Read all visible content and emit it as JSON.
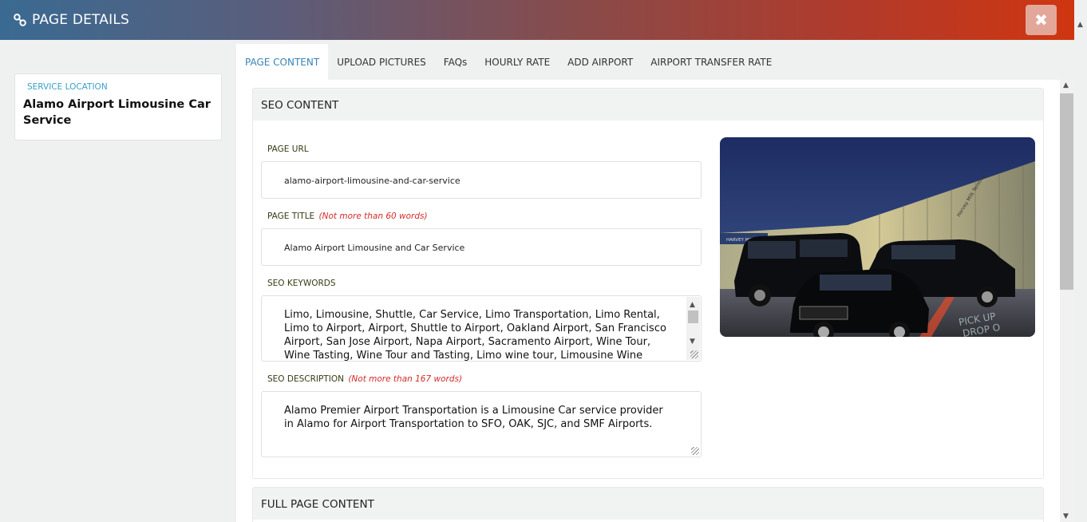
{
  "header": {
    "title": "PAGE DETAILS",
    "link_icon": "link-icon",
    "close_icon": "close-icon",
    "close_label": "✖"
  },
  "sidebar": {
    "service_location_label": "SERVICE LOCATION",
    "service_location_name": "Alamo Airport Limousine Car Service"
  },
  "tabs": [
    {
      "label": "PAGE CONTENT",
      "active": true
    },
    {
      "label": "UPLOAD PICTURES",
      "active": false
    },
    {
      "label": "FAQs",
      "active": false
    },
    {
      "label": "HOURLY RATE",
      "active": false
    },
    {
      "label": "ADD AIRPORT",
      "active": false
    },
    {
      "label": "AIRPORT TRANSFER RATE",
      "active": false
    }
  ],
  "seo": {
    "heading": "SEO CONTENT",
    "page_url_label": "PAGE URL",
    "page_url_value": "alamo-airport-limousine-and-car-service",
    "page_title_label": "PAGE TITLE",
    "page_title_note": "(Not more than 60 words)",
    "page_title_value": "Alamo Airport Limousine and Car Service",
    "keywords_label": "SEO KEYWORDS",
    "keywords_value": "Limo, Limousine, Shuttle, Car Service, Limo Transportation, Limo Rental, Limo to Airport, Airport, Shuttle to Airport, Oakland Airport, San Francisco Airport, San Jose Airport, Napa Airport, Sacramento Airport, Wine Tour, Wine Tasting, Wine Tour and Tasting, Limo wine tour, Limousine Wine Tour,",
    "description_label": "SEO DESCRIPTION",
    "description_note": "(Not more than 167 words)",
    "description_value": "Alamo Premier Airport Transportation is a Limousine Car service provider in Alamo for Airport Transportation to SFO, OAK, SJC, and SMF Airports.",
    "image_sign_1": "Harvey Milk Terminal",
    "image_sign_2": "HARVEY MILK TERM",
    "image_road_1": "PICK UP",
    "image_road_2": "DROP O"
  },
  "full_page": {
    "heading": "FULL PAGE CONTENT"
  }
}
